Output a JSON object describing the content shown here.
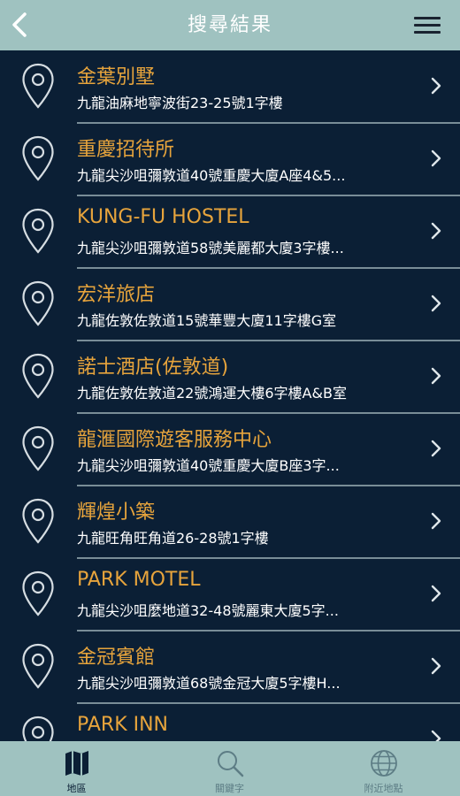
{
  "header": {
    "title": "搜尋結果"
  },
  "results": [
    {
      "name": "金葉別墅",
      "address": "九龍油麻地寧波街23-25號1字樓"
    },
    {
      "name": "重慶招待所",
      "address": "九龍尖沙咀彌敦道40號重慶大廈A座4&5..."
    },
    {
      "name": "KUNG-FU HOSTEL",
      "address": "九龍尖沙咀彌敦道58號美麗都大廈3字樓..."
    },
    {
      "name": "宏洋旅店",
      "address": "九龍佐敦佐敦道15號華豐大廈11字樓G室"
    },
    {
      "name": "諾士酒店(佐敦道)",
      "address": "九龍佐敦佐敦道22號鴻運大樓6字樓A&B室"
    },
    {
      "name": "龍滙國際遊客服務中心",
      "address": "九龍尖沙咀彌敦道40號重慶大廈B座3字..."
    },
    {
      "name": "輝煌小築",
      "address": "九龍旺角旺角道26-28號1字樓"
    },
    {
      "name": "PARK MOTEL",
      "address": "九龍尖沙咀麼地道32-48號麗東大廈5字..."
    },
    {
      "name": "金冠賓館",
      "address": "九龍尖沙咀彌敦道68號金冠大廈5字樓H..."
    },
    {
      "name": "PARK INN",
      "address": ""
    }
  ],
  "tabs": [
    {
      "label": "地區",
      "icon": "map-icon",
      "active": true
    },
    {
      "label": "關鍵字",
      "icon": "search-icon",
      "active": false
    },
    {
      "label": "附近地點",
      "icon": "globe-icon",
      "active": false
    }
  ],
  "colors": {
    "background": "#0b1f35",
    "header": "#9fc2c0",
    "name": "#e7a43c",
    "address": "#ffffff",
    "tab_active": "#0b1f35",
    "tab_inactive": "#5d7d85"
  }
}
